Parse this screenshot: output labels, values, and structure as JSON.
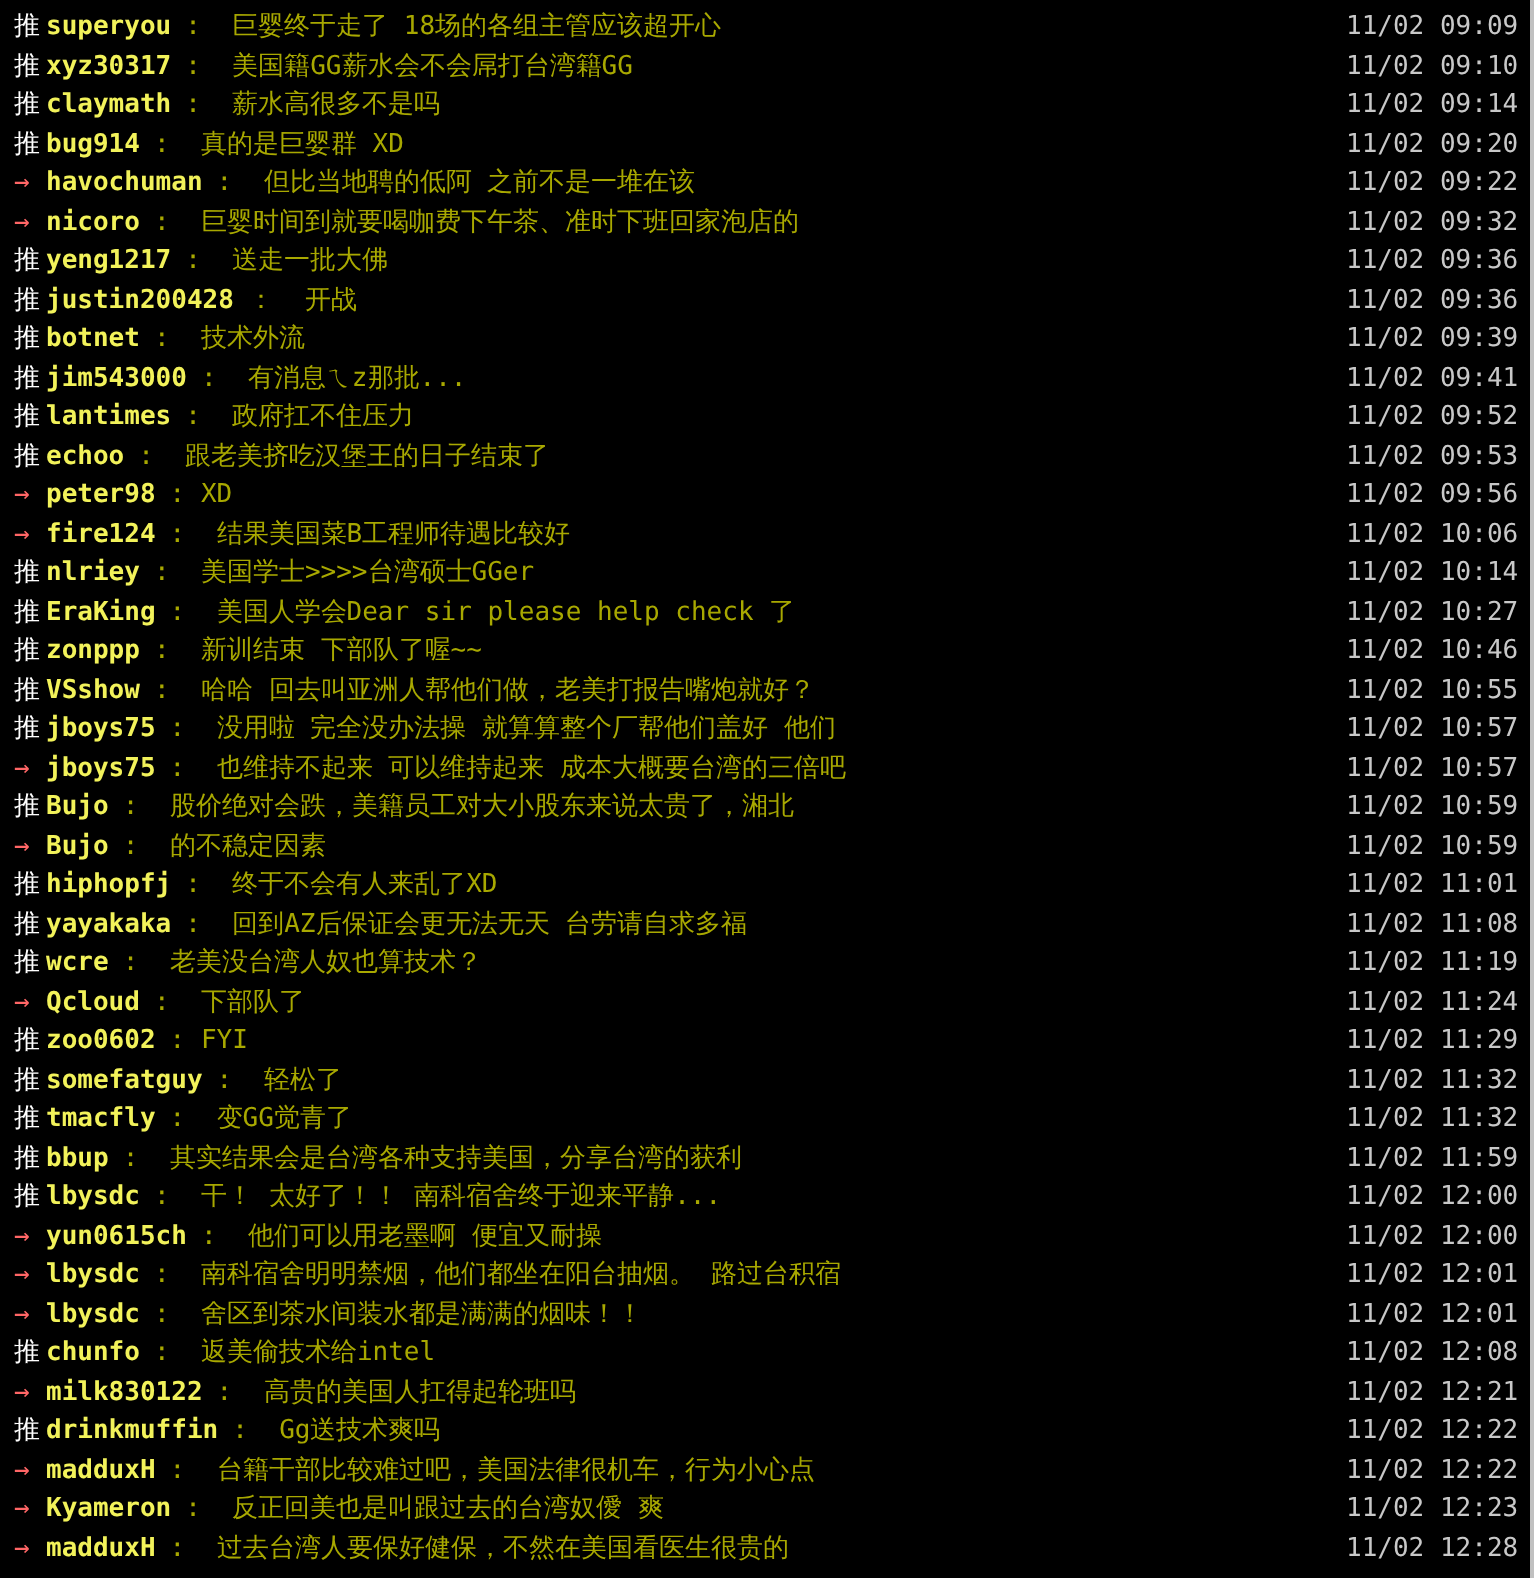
{
  "comments": [
    {
      "kind": "push",
      "tag": "推",
      "user": "superyou",
      "text": ":  巨婴终于走了 18场的各组主管应该超开心",
      "time": "11/02 09:09"
    },
    {
      "kind": "push",
      "tag": "推",
      "user": "xyz30317",
      "text": ":  美国籍GG薪水会不会屌打台湾籍GG",
      "time": "11/02 09:10"
    },
    {
      "kind": "push",
      "tag": "推",
      "user": "claymath",
      "text": ":  薪水高很多不是吗",
      "time": "11/02 09:14"
    },
    {
      "kind": "push",
      "tag": "推",
      "user": "bug914",
      "text": ":  真的是巨婴群 XD",
      "time": "11/02 09:20"
    },
    {
      "kind": "arrow",
      "tag": "→",
      "user": "havochuman",
      "text": ":  但比当地聘的低阿 之前不是一堆在该",
      "time": "11/02 09:22"
    },
    {
      "kind": "arrow",
      "tag": "→",
      "user": "nicoro",
      "text": ":  巨婴时间到就要喝咖费下午茶、准时下班回家泡店的",
      "time": "11/02 09:32"
    },
    {
      "kind": "push",
      "tag": "推",
      "user": "yeng1217",
      "text": ":  送走一批大佛",
      "time": "11/02 09:36"
    },
    {
      "kind": "push",
      "tag": "推",
      "user": "justin200428",
      "text": "：  开战",
      "time": "11/02 09:36"
    },
    {
      "kind": "push",
      "tag": "推",
      "user": "botnet",
      "text": ":  技术外流",
      "time": "11/02 09:39"
    },
    {
      "kind": "push",
      "tag": "推",
      "user": "jim543000",
      "text": ":  有消息ㄟz那批...",
      "time": "11/02 09:41"
    },
    {
      "kind": "push",
      "tag": "推",
      "user": "lantimes",
      "text": ":  政府扛不住压力",
      "time": "11/02 09:52"
    },
    {
      "kind": "push",
      "tag": "推",
      "user": "echoo",
      "text": ":  跟老美挤吃汉堡王的日子结束了",
      "time": "11/02 09:53"
    },
    {
      "kind": "arrow",
      "tag": "→",
      "user": "peter98",
      "text": ": XD",
      "time": "11/02 09:56"
    },
    {
      "kind": "arrow",
      "tag": "→",
      "user": "fire124",
      "text": ":  结果美国菜B工程师待遇比较好",
      "time": "11/02 10:06"
    },
    {
      "kind": "push",
      "tag": "推",
      "user": "nlriey",
      "text": ":  美国学士>>>>台湾硕士GGer",
      "time": "11/02 10:14"
    },
    {
      "kind": "push",
      "tag": "推",
      "user": "EraKing",
      "text": ":  美国人学会Dear sir please help check 了",
      "time": "11/02 10:27"
    },
    {
      "kind": "push",
      "tag": "推",
      "user": "zonppp",
      "text": ":  新训结束 下部队了喔~~",
      "time": "11/02 10:46"
    },
    {
      "kind": "push",
      "tag": "推",
      "user": "VSshow",
      "text": ":  哈哈 回去叫亚洲人帮他们做，老美打报告嘴炮就好？",
      "time": "11/02 10:55"
    },
    {
      "kind": "push",
      "tag": "推",
      "user": "jboys75",
      "text": ":  没用啦 完全没办法操 就算算整个厂帮他们盖好 他们",
      "time": "11/02 10:57"
    },
    {
      "kind": "arrow",
      "tag": "→",
      "user": "jboys75",
      "text": ":  也维持不起来 可以维持起来 成本大概要台湾的三倍吧",
      "time": "11/02 10:57"
    },
    {
      "kind": "push",
      "tag": "推",
      "user": "Bujo",
      "text": ":  股价绝对会跌，美籍员工对大小股东来说太贵了，湘北",
      "time": "11/02 10:59"
    },
    {
      "kind": "arrow",
      "tag": "→",
      "user": "Bujo",
      "text": ":  的不稳定因素",
      "time": "11/02 10:59"
    },
    {
      "kind": "push",
      "tag": "推",
      "user": "hiphopfj",
      "text": ":  终于不会有人来乱了XD",
      "time": "11/02 11:01"
    },
    {
      "kind": "push",
      "tag": "推",
      "user": "yayakaka",
      "text": ":  回到AZ后保证会更无法无天 台劳请自求多福",
      "time": "11/02 11:08"
    },
    {
      "kind": "push",
      "tag": "推",
      "user": "wcre",
      "text": ":  老美没台湾人奴也算技术？",
      "time": "11/02 11:19"
    },
    {
      "kind": "arrow",
      "tag": "→",
      "user": "Qcloud",
      "text": ":  下部队了",
      "time": "11/02 11:24"
    },
    {
      "kind": "push",
      "tag": "推",
      "user": "zoo0602",
      "text": ": FYI",
      "time": "11/02 11:29"
    },
    {
      "kind": "push",
      "tag": "推",
      "user": "somefatguy",
      "text": ":  轻松了",
      "time": "11/02 11:32"
    },
    {
      "kind": "push",
      "tag": "推",
      "user": "tmacfly",
      "text": ":  变GG觉青了",
      "time": "11/02 11:32"
    },
    {
      "kind": "push",
      "tag": "推",
      "user": "bbup",
      "text": ":  其实结果会是台湾各种支持美国，分享台湾的获利",
      "time": "11/02 11:59"
    },
    {
      "kind": "push",
      "tag": "推",
      "user": "lbysdc",
      "text": ":  干！ 太好了！！ 南科宿舍终于迎来平静...",
      "time": "11/02 12:00"
    },
    {
      "kind": "arrow",
      "tag": "→",
      "user": "yun0615ch",
      "text": ":  他们可以用老墨啊 便宜又耐操",
      "time": "11/02 12:00"
    },
    {
      "kind": "arrow",
      "tag": "→",
      "user": "lbysdc",
      "text": ":  南科宿舍明明禁烟，他们都坐在阳台抽烟。 路过台积宿",
      "time": "11/02 12:01"
    },
    {
      "kind": "arrow",
      "tag": "→",
      "user": "lbysdc",
      "text": ":  舍区到茶水间装水都是满满的烟味！！",
      "time": "11/02 12:01"
    },
    {
      "kind": "push",
      "tag": "推",
      "user": "chunfo",
      "text": ":  返美偷技术给intel",
      "time": "11/02 12:08"
    },
    {
      "kind": "arrow",
      "tag": "→",
      "user": "milk830122",
      "text": ":  高贵的美国人扛得起轮班吗",
      "time": "11/02 12:21"
    },
    {
      "kind": "push",
      "tag": "推",
      "user": "drinkmuffin",
      "text": ":  Gg送技术爽吗",
      "time": "11/02 12:22"
    },
    {
      "kind": "arrow",
      "tag": "→",
      "user": "madduxH",
      "text": ":  台籍干部比较难过吧，美国法律很机车，行为小心点",
      "time": "11/02 12:22"
    },
    {
      "kind": "arrow",
      "tag": "→",
      "user": "Kyameron",
      "text": ":  反正回美也是叫跟过去的台湾奴僾 爽",
      "time": "11/02 12:23"
    },
    {
      "kind": "arrow",
      "tag": "→",
      "user": "madduxH",
      "text": ":  过去台湾人要保好健保，不然在美国看医生很贵的",
      "time": "11/02 12:28"
    }
  ]
}
